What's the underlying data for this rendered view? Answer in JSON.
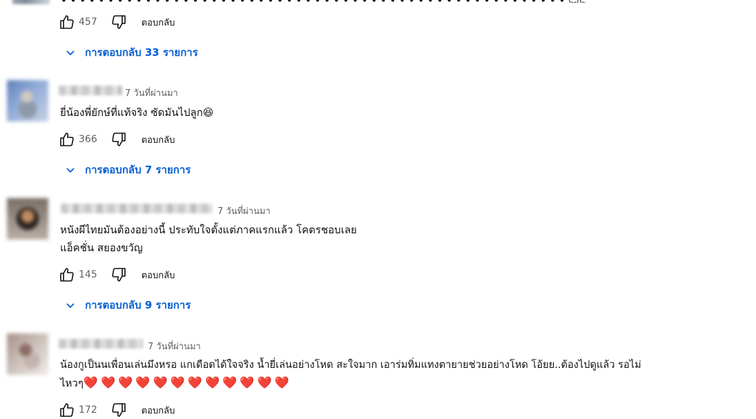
{
  "top": {
    "remnant_text": "• • •  •  •  •  •  •  •  •  •  •  •  •  •  •  •  •  •  •  •  •  •  •  •  •  •  •  •  •  •  •  •  •  •  •  •  •  •  •  •  •  •  •  •  •  •  •  •  •  •  •  •  • 😊😊",
    "like_count": "457",
    "reply_label": "ตอบกลับ",
    "replies_label": "การตอบกลับ 33 รายการ"
  },
  "comments": [
    {
      "time": "7 วันที่ผ่านมา",
      "text_lines": [
        "ยี่น้องพี่ยักษ์ที่แท้จริง ซัดมันไปลูก😆"
      ],
      "like_count": "366",
      "reply_label": "ตอบกลับ",
      "replies_label": "การตอบกลับ 7 รายการ"
    },
    {
      "time": "7 วันที่ผ่านมา",
      "text_lines": [
        "หนังผีไทยมันต้องอย่างนี้ ประทับใจตั้งแต่ภาคแรกแล้ว โคตรชอบเลย",
        "แอ็คชั่น สยองขวัญ"
      ],
      "like_count": "145",
      "reply_label": "ตอบกลับ",
      "replies_label": "การตอบกลับ 9 รายการ"
    },
    {
      "time": "7 วันที่ผ่านมา",
      "text_lines": [
        "น้องกูเป็นนเพื่อนเล่นมึงหรอ แกเดือดได้ใจจริง น้ำยี่เล่นอย่างโหด สะใจมาก เอาร่มทิ่มแทงตายายช่วยอย่างโหด โอ้ยย..ต้องไปดูแล้ว รอไม่",
        "ไหวๆ"
      ],
      "hearts": "❤️❤️❤️❤️❤️❤️❤️❤️❤️❤️❤️❤️",
      "like_count": "172",
      "reply_label": "ตอบกลับ"
    }
  ],
  "colors": {
    "link_blue": "#065fd4",
    "text": "#0f0f0f",
    "meta_gray": "#606060"
  },
  "icons": {
    "like": "thumb-up-icon",
    "dislike": "thumb-down-icon",
    "expand": "chevron-down-icon"
  }
}
